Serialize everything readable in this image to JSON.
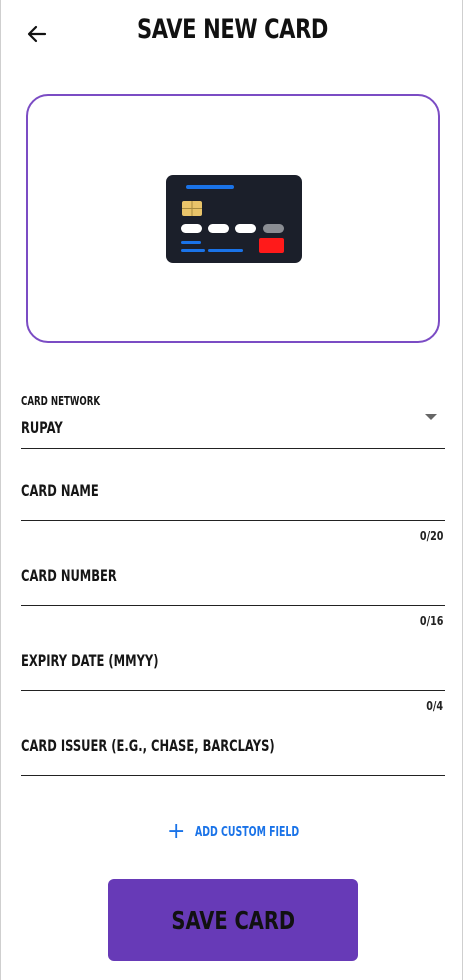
{
  "header": {
    "title": "SAVE NEW CARD",
    "back_icon": "arrow-left-icon"
  },
  "card_preview": {
    "border_color": "#7b4cc4",
    "card_color": "#1b1f2a",
    "accent_blue": "#1a73e8",
    "accent_red": "#ff1a1a",
    "chip_color": "#e9c46a"
  },
  "form": {
    "network": {
      "label": "CARD NETWORK",
      "value": "RUPAY"
    },
    "card_name": {
      "label": "CARD NAME",
      "counter": "0/20"
    },
    "card_number": {
      "label": "CARD NUMBER",
      "counter": "0/16"
    },
    "expiry": {
      "label": "EXPIRY DATE (MMYY)",
      "counter": "0/4"
    },
    "issuer": {
      "label": "CARD ISSUER (E.G., CHASE, BARCLAYS)"
    }
  },
  "add_custom_field": {
    "icon": "plus-icon",
    "label": "ADD CUSTOM FIELD"
  },
  "save_button": {
    "label": "SAVE CARD",
    "color": "#673ab7"
  }
}
